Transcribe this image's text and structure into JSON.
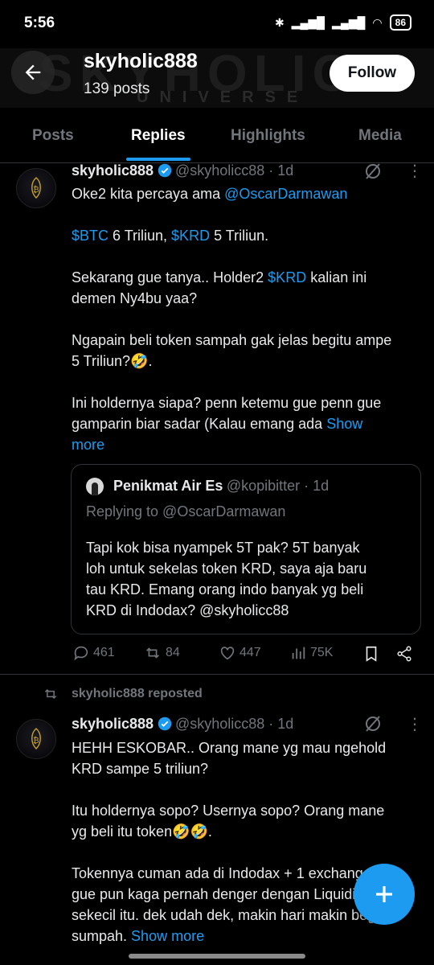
{
  "status": {
    "time": "5:56",
    "battery": "86"
  },
  "header": {
    "banner_text": "SKYHOLIC",
    "banner_sub": "UNIVERSE",
    "name": "skyholic888",
    "posts": "139 posts",
    "follow_label": "Follow"
  },
  "tabs": [
    "Posts",
    "Replies",
    "Highlights",
    "Media"
  ],
  "tweet1": {
    "name": "skyholic888",
    "handle": "@skyholicc88 · 1d",
    "line1a": "Oke2 kita percaya ama ",
    "line1b": "@OscarDarmawan",
    "l2_btc": "$BTC",
    "l2_a": " 6 Triliun, ",
    "l2_krd": "$KRD",
    "l2_b": " 5 Triliun.",
    "l3a": "Sekarang gue tanya.. Holder2 ",
    "l3_krd": "$KRD",
    "l3b": " kalian ini",
    "l4": "demen Ny4bu yaa?",
    "l5": "Ngapain beli token sampah gak jelas begitu ampe",
    "l6": "5 Triliun?🤣.",
    "l7": "Ini holdernya siapa? penn ketemu gue penn gue",
    "l8a": "gamparin biar sadar (Kalau emang ada ",
    "l8_show": "Show",
    "l9_more": "more",
    "quote": {
      "name": "Penikmat Air Es",
      "handle": "@kopibitter · 1d",
      "replying": "Replying to @OscarDarmawan",
      "q1": "Tapi kok bisa nyampek 5T pak? 5T banyak",
      "q2": "loh untuk sekelas token KRD, saya aja baru",
      "q3": "tau KRD. Emang orang indo banyak yg beli",
      "q4": "KRD di Indodax? @skyholicc88"
    },
    "replies": "461",
    "reposts": "84",
    "likes": "447",
    "views": "75K"
  },
  "tweet2": {
    "reposted_label": "skyholic888 reposted",
    "name": "skyholic888",
    "handle": "@skyholicc88 · 1d",
    "l1": "HEHH ESKOBAR.. Orang mane yg mau ngehold",
    "l2": "KRD sampe 5 triliun?",
    "l3": "Itu holdernya sopo? Usernya sopo? Orang mane",
    "l4": "yg beli itu token🤣🤣.",
    "l5": "Tokennya cuman ada di Indodax + 1 exchange yg",
    "l6": "gue pun kaga pernah denger dengan Liquidity",
    "l7": "sekecil itu. dek udah dek, makin hari makin bego",
    "l8a": "sumpah. ",
    "l8_show": "Show more"
  },
  "colors": {
    "accent": "#1d9bf0",
    "muted": "#71767b",
    "background": "#000000"
  }
}
